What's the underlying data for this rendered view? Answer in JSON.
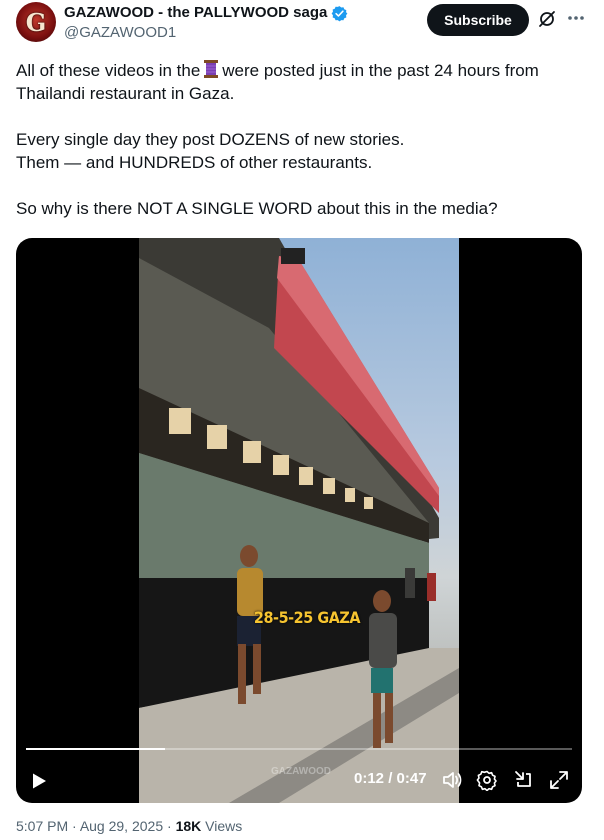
{
  "author": {
    "display_name": "GAZAWOOD - the PALLYWOOD saga",
    "handle": "@GAZAWOOD1",
    "avatar_letter": "G",
    "verified": true
  },
  "actions": {
    "subscribe_label": "Subscribe",
    "grok_icon": "grok-icon",
    "more_icon": "more-icon"
  },
  "tweet": {
    "line1_a": "All of these videos in the",
    "emoji": "thread-spool-emoji",
    "line1_b": "were posted just in the past 24 hours from",
    "line2": "Thailandi restaurant in Gaza.",
    "line3": "Every single day they post DOZENS of new stories.",
    "line4": "Them — and HUNDREDS of other restaurants.",
    "line5": "So why is there NOT A SINGLE WORD about this in the media?"
  },
  "video": {
    "overlay_caption": "28-5-25 GAZA",
    "watermark": "GAZAWOOD",
    "current_time": "0:12",
    "duration": "0:47",
    "time_display": "0:12 / 0:47",
    "progress_fraction": 0.255,
    "controls": [
      "play-icon",
      "volume-icon",
      "settings-icon",
      "minimize-icon",
      "fullscreen-icon"
    ]
  },
  "meta": {
    "time": "5:07 PM",
    "date": "Aug 29, 2025",
    "views_count": "18K",
    "views_label": "Views"
  },
  "colors": {
    "text": "#0f1419",
    "secondary": "#536471",
    "verified_blue": "#1d9bf0",
    "caption_yellow": "#f6c430"
  }
}
